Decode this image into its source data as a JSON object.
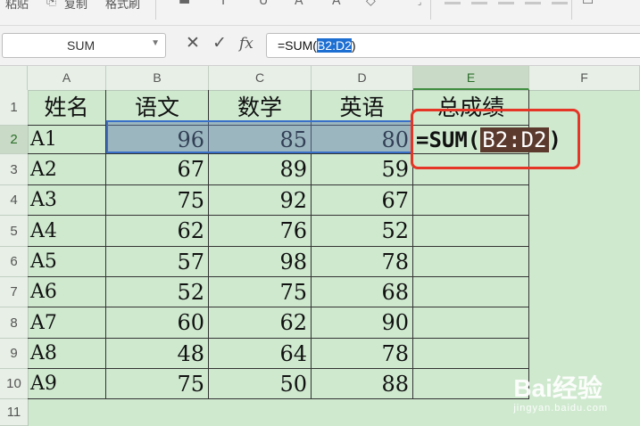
{
  "toolbar": {
    "items": [
      "粘贴",
      "复制",
      "格式刷"
    ],
    "icons": [
      "paste-icon",
      "copy-icon",
      "format-painter-icon",
      "font-bold-icon",
      "italic-icon",
      "underline-icon",
      "merge-center-icon"
    ]
  },
  "formula_bar": {
    "name_box": "SUM",
    "cancel_icon": "✕",
    "confirm_icon": "✓",
    "fx_label": "fx",
    "formula_prefix": "=SUM(",
    "formula_selected": "B2:D2",
    "formula_suffix": ")"
  },
  "columns": [
    "A",
    "B",
    "C",
    "D",
    "E",
    "F"
  ],
  "rows": [
    "1",
    "2",
    "3",
    "4",
    "5",
    "6",
    "7",
    "8",
    "9",
    "10",
    "11"
  ],
  "table": {
    "headers": [
      "姓名",
      "语文",
      "数学",
      "英语",
      "总成绩"
    ],
    "rows": [
      [
        "A1",
        "96",
        "85",
        "80"
      ],
      [
        "A2",
        "67",
        "89",
        "59"
      ],
      [
        "A3",
        "75",
        "92",
        "67"
      ],
      [
        "A4",
        "62",
        "76",
        "52"
      ],
      [
        "A5",
        "57",
        "98",
        "78"
      ],
      [
        "A6",
        "52",
        "75",
        "68"
      ],
      [
        "A7",
        "60",
        "62",
        "90"
      ],
      [
        "A8",
        "48",
        "64",
        "78"
      ],
      [
        "A9",
        "75",
        "50",
        "88"
      ]
    ]
  },
  "active_cell": {
    "formula_prefix": "=SUM(",
    "formula_ref": "B2:D2",
    "formula_suffix": ")"
  },
  "watermark": {
    "brand": "Bai经验",
    "url": "jingyan.baidu.com"
  },
  "colors": {
    "sheet_bg": "#cfe9cf",
    "selection": "#3a6fc8",
    "callout": "#e53527"
  }
}
